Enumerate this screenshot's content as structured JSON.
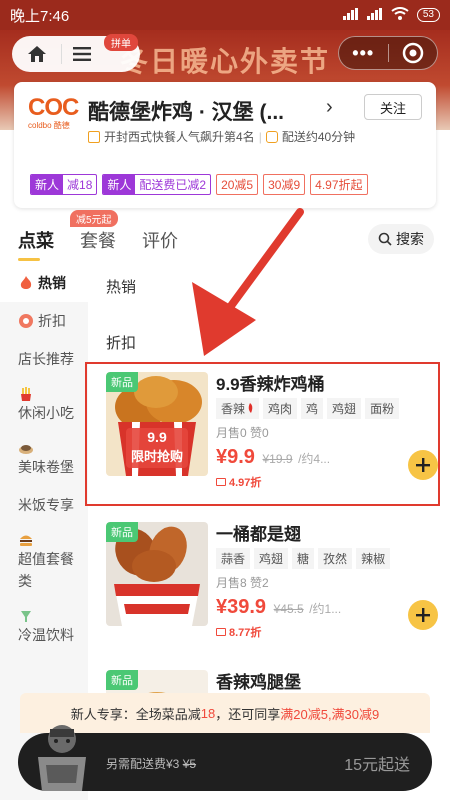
{
  "status_bar": {
    "time": "晚上7:46",
    "battery": "53"
  },
  "header": {
    "banner_text": "冬日暖心外卖节",
    "pindan_badge": "拼单"
  },
  "shop": {
    "logo_text": "COC",
    "logo_subtext": "coldbo 酷德",
    "name": "酷德堡炸鸡 · 汉堡 (...",
    "follow_label": "关注",
    "ranking": "开封西式快餐人气飙升第4名",
    "delivery_time": "配送约40分钟",
    "promos": [
      {
        "tag": "新人",
        "text": "减18"
      },
      {
        "tag": "新人",
        "text": "配送费已减2"
      }
    ],
    "discount_tags": [
      "20减5",
      "30减9",
      "4.97折起"
    ]
  },
  "tabs": {
    "items": [
      "点菜",
      "套餐",
      "评价"
    ],
    "promo_bubble": "减5元起",
    "search_label": "搜索"
  },
  "sidebar": {
    "items": [
      {
        "label": "热销",
        "icon": "fire-icon"
      },
      {
        "label": "折扣",
        "icon": "discount-icon"
      },
      {
        "label": "店长推荐",
        "icon": ""
      },
      {
        "label": "休闲小吃",
        "icon": "fries-icon"
      },
      {
        "label": "美味卷堡",
        "icon": "wrap-icon"
      },
      {
        "label": "米饭专享",
        "icon": ""
      },
      {
        "label": "超值套餐类",
        "icon": "burger-icon"
      },
      {
        "label": "冷温饮料",
        "icon": "drink-icon"
      }
    ]
  },
  "menu": {
    "section_hot": "热销",
    "section_discount": "折扣",
    "items": [
      {
        "badge": "新品",
        "name": "9.9香辣炸鸡桶",
        "tags": [
          "香辣",
          "鸡肉",
          "鸡",
          "鸡翅",
          "面粉"
        ],
        "sales": "月售0   赞0",
        "price": "¥9.9",
        "original_price": "¥19.9",
        "per_unit": "/约4...",
        "discount": "4.97折",
        "image_text_1": "9.9",
        "image_text_2": "限时抢购"
      },
      {
        "badge": "新品",
        "name": "一桶都是翅",
        "tags": [
          "蒜香",
          "鸡翅",
          "糖",
          "孜然",
          "辣椒"
        ],
        "sales": "月售8   赞2",
        "price": "¥39.9",
        "original_price": "¥45.5",
        "per_unit": "/约1...",
        "discount": "8.77折"
      },
      {
        "badge": "新品",
        "name": "香辣鸡腿堡"
      }
    ]
  },
  "bottom": {
    "newcomer_prefix": "新人专享：全场菜品减 ",
    "newcomer_amount": "18",
    "newcomer_middle": "，还可同享 ",
    "newcomer_discounts": "满20减5,满30减9",
    "delivery_note": "另需配送费¥3",
    "delivery_original": "¥5",
    "min_order": "15元起送"
  },
  "colors": {
    "accent": "#f7c445",
    "price_red": "#f0493b",
    "header_red": "#a52d1e",
    "new_badge": "#4bc874",
    "promo_purple": "#9d38d8"
  }
}
